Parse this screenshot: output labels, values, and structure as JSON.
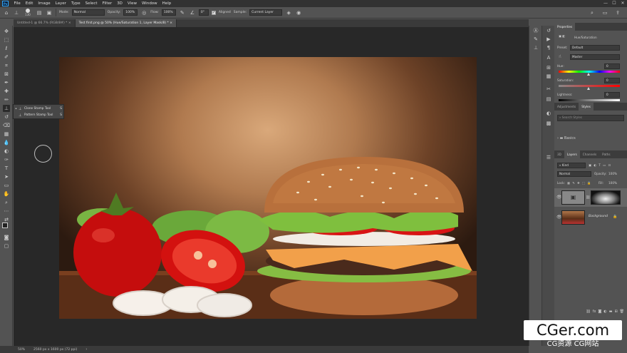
{
  "app": {
    "logo": "Ps"
  },
  "menu": [
    "File",
    "Edit",
    "Image",
    "Layer",
    "Type",
    "Select",
    "Filter",
    "3D",
    "View",
    "Window",
    "Help"
  ],
  "window_controls": [
    "—",
    "☐",
    "✕"
  ],
  "options_bar": {
    "brush_size": "130",
    "mode_label": "Mode:",
    "mode_value": "Normal",
    "opacity_label": "Opacity:",
    "opacity_value": "100%",
    "flow_label": "Flow:",
    "flow_value": "100%",
    "angle_value": "0°",
    "aligned_label": "Aligned",
    "sample_label": "Sample:",
    "sample_value": "Current Layer"
  },
  "tabs": [
    {
      "label": "Untitled-1 @ 66.7% (RGB/8#) *",
      "active": false
    },
    {
      "label": "Test first.png @ 50% (Hue/Saturation 1, Layer Mask/8) *",
      "active": true
    }
  ],
  "flyout": [
    {
      "label": "Clone Stamp Tool",
      "key": "S",
      "selected": true
    },
    {
      "label": "Pattern Stamp Tool",
      "key": "S",
      "selected": false
    }
  ],
  "properties": {
    "tab": "Properties",
    "adjustment_name": "Hue/Saturation",
    "preset_label": "Preset:",
    "preset_value": "Default",
    "channel_value": "Master",
    "hue_label": "Hue:",
    "hue_value": "0",
    "saturation_label": "Saturation:",
    "saturation_value": "0",
    "lightness_label": "Lightness:",
    "lightness_value": "0"
  },
  "styles_panel": {
    "tabs": [
      "Adjustments",
      "Styles"
    ],
    "active_tab": "Styles",
    "search_placeholder": "Search Styles",
    "folder_label": "Basics"
  },
  "layers_panel": {
    "tabs": [
      "3D",
      "Layers",
      "Channels",
      "Paths"
    ],
    "active_tab": "Layers",
    "filter_value": "Kind",
    "blend_value": "Normal",
    "opacity_label": "Opacity:",
    "opacity_value": "100%",
    "lock_label": "Lock:",
    "fill_label": "Fill:",
    "fill_value": "100%",
    "layers": [
      {
        "name": "",
        "type": "adjustment"
      },
      {
        "name": "Background",
        "type": "image"
      }
    ]
  },
  "status": {
    "zoom": "50%",
    "doc_size": "2560 px x 1600 px (72 ppi)"
  },
  "watermark": {
    "main": "CGer.com",
    "sub": "CG资源 CG网站"
  },
  "colors": {
    "accent": "#31a8ff",
    "panel": "#535353",
    "canvas_bg": "#282828"
  }
}
